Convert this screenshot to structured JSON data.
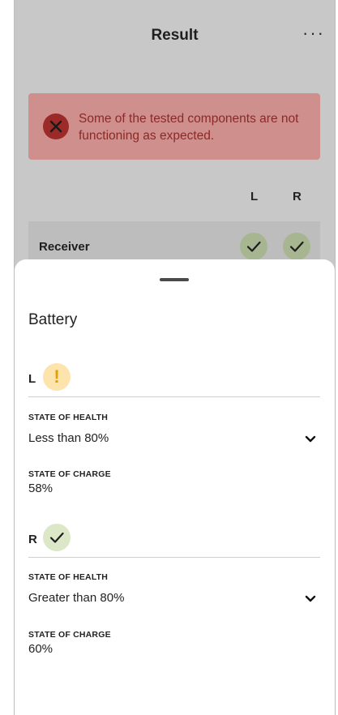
{
  "header": {
    "title": "Result",
    "more_icon": "more-horizontal-icon",
    "more_glyph": "···"
  },
  "alert": {
    "icon": "error-x-icon",
    "message": "Some of the tested components are not functioning as expected.",
    "background": "#cf8f8d",
    "icon_color": "#9b2a29"
  },
  "columns": {
    "left": "L",
    "right": "R"
  },
  "components": [
    {
      "label": "Receiver",
      "left_status": "pass",
      "right_status": "pass"
    }
  ],
  "sheet": {
    "title": "Battery",
    "sides": [
      {
        "letter": "L",
        "status": "warning",
        "status_glyph": "!",
        "state_of_health_label": "STATE OF HEALTH",
        "state_of_health_value": "Less than 80%",
        "state_of_charge_label": "STATE OF CHARGE",
        "state_of_charge_value": "58%"
      },
      {
        "letter": "R",
        "status": "pass",
        "state_of_health_label": "STATE OF HEALTH",
        "state_of_health_value": "Greater than 80%",
        "state_of_charge_label": "STATE OF CHARGE",
        "state_of_charge_value": "60%"
      }
    ]
  },
  "colors": {
    "warning": "#fde4ad",
    "pass": "#dce7c8",
    "dim_overlay": "#c8c8c8"
  }
}
